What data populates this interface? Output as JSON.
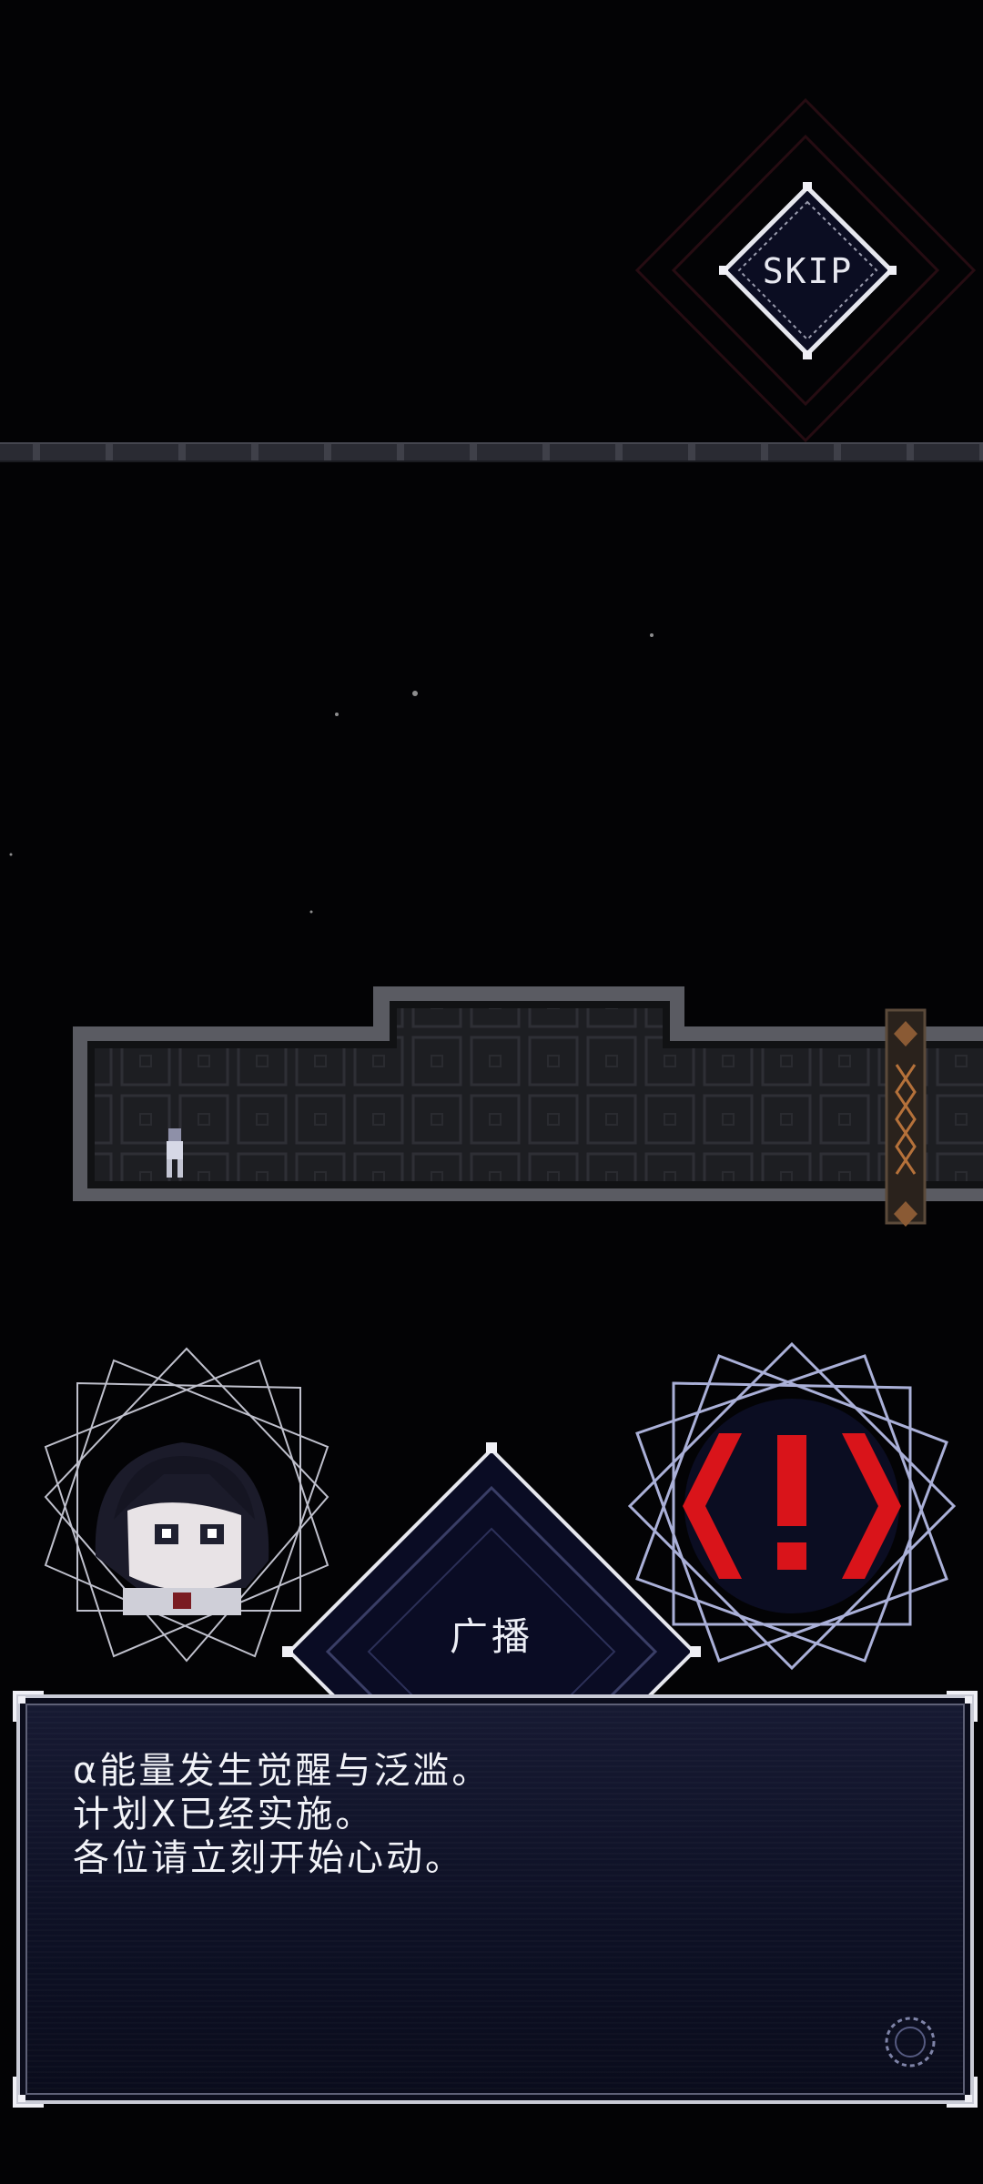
{
  "skip_button": {
    "label": "SKIP"
  },
  "speaker": {
    "name": "广播"
  },
  "dialog": {
    "lines": [
      "α能量发生觉醒与泛滥。",
      "计划X已经实施。",
      "各位请立刻开始心动。"
    ]
  },
  "colors": {
    "background": "#030305",
    "panel": "#121530",
    "frame": "#c9cbd6",
    "alert_red": "#d9141a",
    "text": "#f2f3f8"
  },
  "icons": {
    "alert": "exclamation-alert-icon",
    "advance": "advance-indicator-icon",
    "player": "player-sprite",
    "portrait": "character-portrait"
  }
}
